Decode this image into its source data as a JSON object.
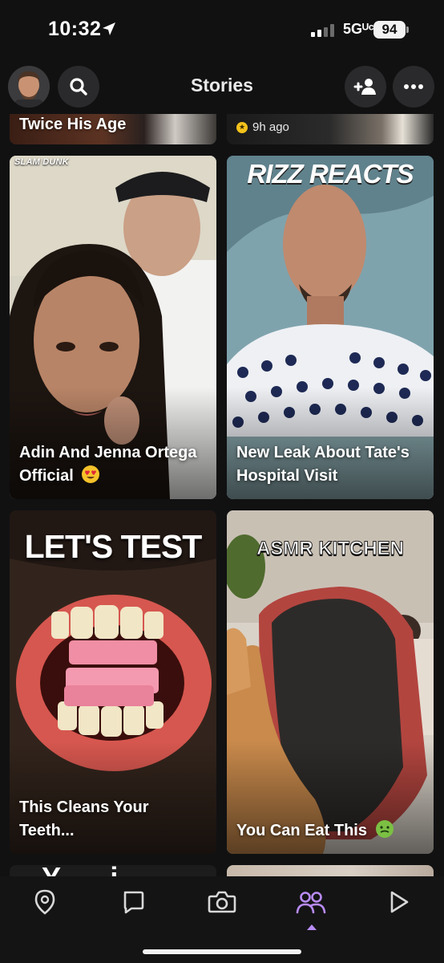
{
  "status_bar": {
    "time": "10:32",
    "network": "5Gᵁᶜ",
    "battery": "94"
  },
  "header": {
    "title": "Stories"
  },
  "top_partial": {
    "left_title": "Twice His Age",
    "right_time": "9h ago"
  },
  "cards": [
    {
      "brand": "SLAM DUNK",
      "title": "Adin And Jenna Ortega Official",
      "emoji": "heart-eyes-emoji"
    },
    {
      "brand": "RIZZ REACTS",
      "title": "New Leak About Tate's Hospital Visit"
    },
    {
      "brand": "LET'S TEST",
      "title": "This Cleans Your Teeth..."
    },
    {
      "brand": "ASMR KITCHEN",
      "title": "You Can Eat This",
      "emoji": "nauseated-face-emoji"
    }
  ],
  "bottom_partial": {
    "left_letters": "Y  i"
  },
  "tab_bar": {
    "active": "stories",
    "items": [
      "map",
      "chat",
      "camera",
      "stories",
      "spotlight"
    ]
  },
  "colors": {
    "background": "#111112",
    "accent": "#b98cf5",
    "button_bg": "#2a2a2c"
  }
}
